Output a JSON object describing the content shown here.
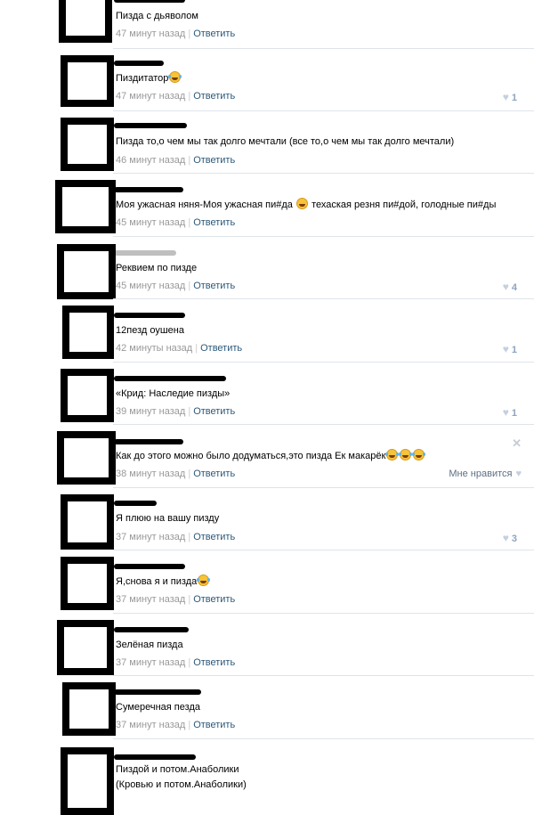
{
  "actions": {
    "reply": "Ответить",
    "like_label": "Мне нравится"
  },
  "comments": [
    {
      "text": "Пизда с дьяволом",
      "time": "47 минут назад",
      "likes": ""
    },
    {
      "text": "Пиздитатор",
      "time": "47 минут назад",
      "likes": "1"
    },
    {
      "text": "Пизда то,о чем мы так долго мечтали (все то,о чем мы так долго мечтали)",
      "time": "46 минут назад",
      "likes": ""
    },
    {
      "text_a": "Моя ужасная няня-Моя ужасная пи#да",
      "text_b": "техаская резня пи#дой, голодные пи#ды",
      "time": "45 минут назад",
      "likes": ""
    },
    {
      "text": "Реквием по пизде",
      "time": "45 минут назад",
      "likes": "4"
    },
    {
      "text": "12пезд оушена",
      "time": "42 минуты назад",
      "likes": "1"
    },
    {
      "text": "«Крид: Наследие пизды»",
      "time": "39 минут назад",
      "likes": "1"
    },
    {
      "text": "Как до этого можно было додуматься,это пизда Ек макарёк",
      "time": "38 минут назад",
      "likes": ""
    },
    {
      "text": "Я плюю на вашу пизду",
      "time": "37 минут назад",
      "likes": "3"
    },
    {
      "text": "Я,снова я и пизда",
      "time": "37 минут назад",
      "likes": ""
    },
    {
      "text": "Зелёная пизда",
      "time": "37 минут назад",
      "likes": ""
    },
    {
      "text": "Сумеречная пезда",
      "time": "37 минут назад",
      "likes": ""
    },
    {
      "text": "Пиздой и потом.Анаболики",
      "text2": "(Кровью и потом.Анаболики)",
      "time": "",
      "likes": ""
    }
  ],
  "icons": {
    "like": "heart-icon",
    "close": "close-icon",
    "emoji": "laughing-emoji-icon"
  }
}
